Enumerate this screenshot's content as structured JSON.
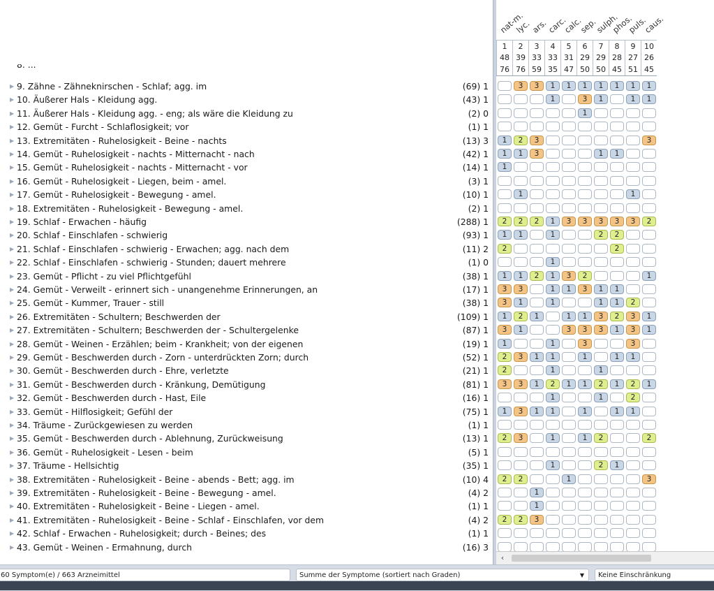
{
  "remedies": [
    "nat-m.",
    "lyc.",
    "ars.",
    "carc.",
    "calc.",
    "sep.",
    "sulph.",
    "phos.",
    "puls.",
    "caus."
  ],
  "remedy_numbers": [
    "1",
    "2",
    "3",
    "4",
    "5",
    "6",
    "7",
    "8",
    "9",
    "10"
  ],
  "remedy_counts": [
    "48",
    "39",
    "33",
    "33",
    "31",
    "29",
    "29",
    "28",
    "27",
    "26"
  ],
  "remedy_sums": [
    "76",
    "76",
    "59",
    "35",
    "47",
    "50",
    "50",
    "45",
    "51",
    "45"
  ],
  "rubrics": [
    {
      "text": "9. Zähne - Zähneknirschen - Schlaf; agg. im",
      "count": "(69) 1",
      "grades": [
        0,
        3,
        3,
        1,
        1,
        1,
        1,
        1,
        1,
        1
      ]
    },
    {
      "text": "10. Äußerer Hals - Kleidung agg.",
      "count": "(43) 1",
      "grades": [
        0,
        0,
        0,
        1,
        0,
        3,
        1,
        0,
        1,
        1
      ]
    },
    {
      "text": "11. Äußerer Hals - Kleidung agg. - eng; als wäre die Kleidung zu",
      "count": "(2) 0",
      "grades": [
        0,
        0,
        0,
        0,
        0,
        1,
        0,
        0,
        0,
        0
      ]
    },
    {
      "text": "12. Gemüt - Furcht - Schlaflosigkeit; vor",
      "count": "(1) 1",
      "grades": [
        0,
        0,
        0,
        0,
        0,
        0,
        0,
        0,
        0,
        0
      ]
    },
    {
      "text": "13. Extremitäten - Ruhelosigkeit - Beine - nachts",
      "count": "(13) 3",
      "grades": [
        1,
        2,
        3,
        0,
        0,
        0,
        0,
        0,
        0,
        3
      ]
    },
    {
      "text": "14. Gemüt - Ruhelosigkeit - nachts - Mitternacht - nach",
      "count": "(42) 1",
      "grades": [
        1,
        1,
        3,
        0,
        0,
        0,
        1,
        1,
        0,
        0
      ]
    },
    {
      "text": "15. Gemüt - Ruhelosigkeit - nachts - Mitternacht - vor",
      "count": "(14) 1",
      "grades": [
        1,
        0,
        0,
        0,
        0,
        0,
        0,
        0,
        0,
        0
      ]
    },
    {
      "text": "16. Gemüt - Ruhelosigkeit - Liegen, beim - amel.",
      "count": "(3) 1",
      "grades": [
        0,
        0,
        0,
        0,
        0,
        0,
        0,
        0,
        0,
        0
      ]
    },
    {
      "text": "17. Gemüt - Ruhelosigkeit - Bewegung - amel.",
      "count": "(10) 1",
      "grades": [
        0,
        1,
        0,
        0,
        0,
        0,
        0,
        0,
        1,
        0
      ]
    },
    {
      "text": "18. Extremitäten - Ruhelosigkeit - Bewegung - amel.",
      "count": "(2) 1",
      "grades": [
        0,
        0,
        0,
        0,
        0,
        0,
        0,
        0,
        0,
        0
      ]
    },
    {
      "text": "19. Schlaf - Erwachen - häufig",
      "count": "(288) 1",
      "grades": [
        2,
        2,
        2,
        1,
        3,
        3,
        3,
        3,
        3,
        2
      ]
    },
    {
      "text": "20. Schlaf - Einschlafen - schwierig",
      "count": "(93) 1",
      "grades": [
        1,
        1,
        0,
        1,
        0,
        0,
        2,
        2,
        0,
        0
      ]
    },
    {
      "text": "21. Schlaf - Einschlafen - schwierig - Erwachen; agg. nach dem",
      "count": "(11) 2",
      "grades": [
        2,
        0,
        0,
        0,
        0,
        0,
        0,
        2,
        0,
        0
      ]
    },
    {
      "text": "22. Schlaf - Einschlafen - schwierig - Stunden; dauert mehrere",
      "count": "(1) 0",
      "grades": [
        0,
        0,
        0,
        1,
        0,
        0,
        0,
        0,
        0,
        0
      ]
    },
    {
      "text": "23. Gemüt - Pflicht - zu viel Pflichtgefühl",
      "count": "(38) 1",
      "grades": [
        1,
        1,
        2,
        1,
        3,
        2,
        0,
        0,
        0,
        1
      ]
    },
    {
      "text": "24. Gemüt - Verweilt - erinnert sich - unangenehme Erinnerungen, an",
      "count": "(17) 1",
      "grades": [
        3,
        3,
        0,
        1,
        1,
        3,
        1,
        1,
        0,
        0
      ]
    },
    {
      "text": "25. Gemüt - Kummer, Trauer - still",
      "count": "(38) 1",
      "grades": [
        3,
        1,
        0,
        1,
        0,
        0,
        1,
        1,
        2,
        0
      ]
    },
    {
      "text": "26. Extremitäten - Schultern; Beschwerden der",
      "count": "(109) 1",
      "grades": [
        1,
        2,
        1,
        0,
        1,
        1,
        3,
        2,
        3,
        1
      ]
    },
    {
      "text": "27. Extremitäten - Schultern; Beschwerden der - Schultergelenke",
      "count": "(87) 1",
      "grades": [
        3,
        1,
        0,
        0,
        3,
        3,
        3,
        1,
        3,
        1
      ]
    },
    {
      "text": "28. Gemüt - Weinen - Erzählen; beim - Krankheit; von der eigenen",
      "count": "(19) 1",
      "grades": [
        1,
        0,
        0,
        1,
        0,
        3,
        0,
        0,
        3,
        0
      ]
    },
    {
      "text": "29. Gemüt - Beschwerden durch - Zorn - unterdrückten Zorn; durch",
      "count": "(52) 1",
      "grades": [
        2,
        3,
        1,
        1,
        0,
        1,
        0,
        1,
        1,
        0
      ]
    },
    {
      "text": "30. Gemüt - Beschwerden durch - Ehre, verletzte",
      "count": "(21) 1",
      "grades": [
        2,
        0,
        0,
        1,
        0,
        0,
        1,
        0,
        0,
        0
      ]
    },
    {
      "text": "31. Gemüt - Beschwerden durch - Kränkung, Demütigung",
      "count": "(81) 1",
      "grades": [
        3,
        3,
        1,
        2,
        1,
        1,
        2,
        1,
        2,
        1
      ]
    },
    {
      "text": "32. Gemüt - Beschwerden durch - Hast, Eile",
      "count": "(16) 1",
      "grades": [
        0,
        0,
        0,
        1,
        0,
        0,
        1,
        0,
        2,
        0
      ]
    },
    {
      "text": "33. Gemüt - Hilflosigkeit; Gefühl der",
      "count": "(75) 1",
      "grades": [
        1,
        3,
        1,
        1,
        0,
        1,
        0,
        1,
        1,
        0
      ]
    },
    {
      "text": "34. Träume - Zurückgewiesen zu werden",
      "count": "(1) 1",
      "grades": [
        0,
        0,
        0,
        0,
        0,
        0,
        0,
        0,
        0,
        0
      ]
    },
    {
      "text": "35. Gemüt - Beschwerden durch - Ablehnung, Zurückweisung",
      "count": "(13) 1",
      "grades": [
        2,
        3,
        0,
        1,
        0,
        1,
        2,
        0,
        0,
        2
      ]
    },
    {
      "text": "36. Gemüt - Ruhelosigkeit - Lesen - beim",
      "count": "(5) 1",
      "grades": [
        0,
        0,
        0,
        0,
        0,
        0,
        0,
        0,
        0,
        0
      ]
    },
    {
      "text": "37. Träume - Hellsichtig",
      "count": "(35) 1",
      "grades": [
        0,
        0,
        0,
        1,
        0,
        0,
        2,
        1,
        0,
        0
      ]
    },
    {
      "text": "38. Extremitäten - Ruhelosigkeit - Beine - abends - Bett; agg. im",
      "count": "(10) 4",
      "grades": [
        2,
        2,
        0,
        0,
        1,
        0,
        0,
        0,
        0,
        3
      ]
    },
    {
      "text": "39. Extremitäten - Ruhelosigkeit - Beine - Bewegung - amel.",
      "count": "(4) 2",
      "grades": [
        0,
        0,
        1,
        0,
        0,
        0,
        0,
        0,
        0,
        0
      ]
    },
    {
      "text": "40. Extremitäten - Ruhelosigkeit - Beine - Liegen - amel.",
      "count": "(1) 1",
      "grades": [
        0,
        0,
        1,
        0,
        0,
        0,
        0,
        0,
        0,
        0
      ]
    },
    {
      "text": "41. Extremitäten - Ruhelosigkeit - Beine - Schlaf - Einschlafen, vor dem",
      "count": "(4) 2",
      "grades": [
        2,
        2,
        3,
        0,
        0,
        0,
        0,
        0,
        0,
        0
      ]
    },
    {
      "text": "42. Schlaf - Erwachen - Ruhelosigkeit; durch - Beines; des",
      "count": "(1) 1",
      "grades": [
        0,
        0,
        0,
        0,
        0,
        0,
        0,
        0,
        0,
        0
      ]
    },
    {
      "text": "43. Gemüt - Weinen - Ermahnung, durch",
      "count": "(16) 3",
      "grades": [
        0,
        0,
        0,
        0,
        0,
        0,
        0,
        0,
        0,
        0
      ]
    }
  ],
  "status": {
    "symptom_count": "60 Symptom(e) / 663 Arzneimittel",
    "sort_mode": "Summe der Symptome (sortiert nach Graden)",
    "restriction": "Keine Einschränkung"
  },
  "icons": {
    "expand": "triangle-right-icon",
    "dropdown": "chevron-down-icon",
    "scroll_left": "arrow-left-icon"
  },
  "colors": {
    "grade1": "#c8d6e6",
    "grade2": "#dfee8f",
    "grade3": "#f3c485"
  }
}
